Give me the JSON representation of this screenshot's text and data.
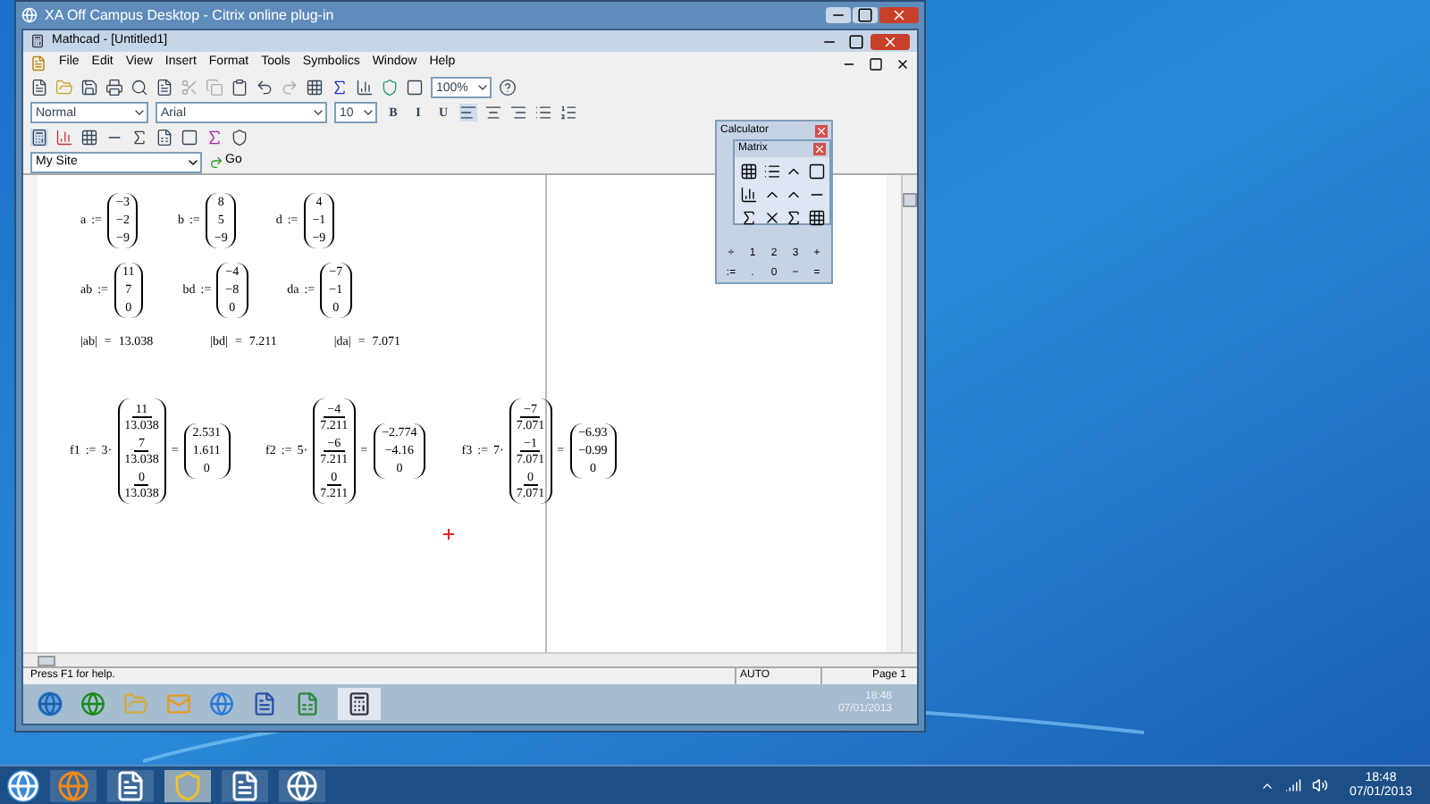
{
  "window": {
    "title": "XA Off Campus Desktop - Citrix online plug-in"
  },
  "app": {
    "title": "Mathcad - [Untitled1]",
    "menu": [
      "File",
      "Edit",
      "View",
      "Insert",
      "Format",
      "Tools",
      "Symbolics",
      "Window",
      "Help"
    ],
    "zoom": "100%",
    "style": "Normal",
    "font": "Arial",
    "size": "10",
    "format_buttons": [
      "B",
      "I",
      "U"
    ],
    "site": "My Site",
    "go": "Go"
  },
  "worksheet": {
    "definitions": [
      [
        {
          "name": "a",
          "op": ":=",
          "values": [
            "−3",
            "−2",
            "−9"
          ]
        },
        {
          "name": "b",
          "op": ":=",
          "values": [
            "8",
            "5",
            "−9"
          ]
        },
        {
          "name": "d",
          "op": ":=",
          "values": [
            "4",
            "−1",
            "−9"
          ]
        }
      ],
      [
        {
          "name": "ab",
          "op": ":=",
          "values": [
            "11",
            "7",
            "0"
          ]
        },
        {
          "name": "bd",
          "op": ":=",
          "values": [
            "−4",
            "−8",
            "0"
          ]
        },
        {
          "name": "da",
          "op": ":=",
          "values": [
            "−7",
            "−1",
            "0"
          ]
        }
      ]
    ],
    "norms": [
      {
        "expr": "|ab|",
        "op": "=",
        "value": "13.038"
      },
      {
        "expr": "|bd|",
        "op": "=",
        "value": "7.211"
      },
      {
        "expr": "|da|",
        "op": "=",
        "value": "7.071"
      }
    ],
    "formulas": [
      {
        "name": "f1",
        "op": ":=",
        "factor": "3·",
        "fractions": [
          {
            "num": "11",
            "den": "13.038"
          },
          {
            "num": "7",
            "den": "13.038"
          },
          {
            "num": "0",
            "den": "13.038"
          }
        ],
        "eq": "=",
        "result": [
          "2.531",
          "1.611",
          "0"
        ]
      },
      {
        "name": "f2",
        "op": ":=",
        "factor": "5·",
        "fractions": [
          {
            "num": "−4",
            "den": "7.211"
          },
          {
            "num": "−6",
            "den": "7.211"
          },
          {
            "num": "0",
            "den": "7.211"
          }
        ],
        "eq": "=",
        "result": [
          "−2.774",
          "−4.16",
          "0"
        ]
      },
      {
        "name": "f3",
        "op": ":=",
        "factor": "7·",
        "fractions": [
          {
            "num": "−7",
            "den": "7.071"
          },
          {
            "num": "−1",
            "den": "7.071"
          },
          {
            "num": "0",
            "den": "7.071"
          }
        ],
        "eq": "=",
        "result": [
          "−6.93",
          "−0.99",
          "0"
        ]
      }
    ]
  },
  "calculator": {
    "title": "Calculator",
    "matrix_title": "Matrix",
    "keys": [
      [
        "÷",
        "1",
        "2",
        "3",
        "+"
      ],
      [
        ":=",
        ".",
        "0",
        "−",
        "="
      ]
    ]
  },
  "status_bar": {
    "help": "Press F1 for help.",
    "mode": "AUTO",
    "page": "Page 1"
  },
  "remote_taskbar": {
    "time": "18:48",
    "date": "07/01/2013"
  },
  "taskbar": {
    "time": "18:48",
    "date": "07/01/2013"
  }
}
